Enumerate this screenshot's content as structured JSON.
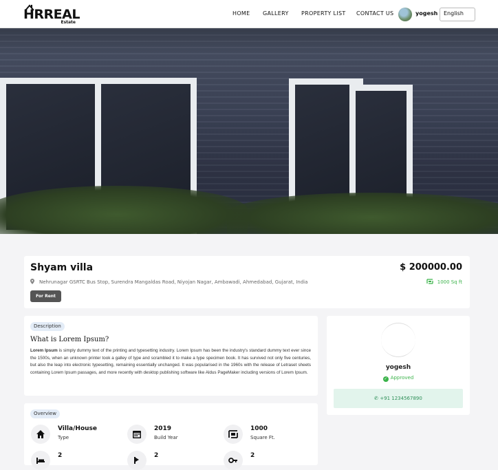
{
  "nav": {
    "logo_main": "HRREAL",
    "logo_sub": "Estate",
    "links": [
      "HOME",
      "GALLERY",
      "PROPERTY LIST",
      "CONTACT US"
    ],
    "user_name": "yogesh",
    "language": "English"
  },
  "property": {
    "title": "Shyam villa",
    "price": "$ 200000.00",
    "address": "Nehrunagar GSRTC Bus Stop, Surendra Mangaldas Road, Niyojan Nagar, Ambawadi, Ahmedabad, Gujarat, India",
    "area": "1000 Sq ft",
    "status_badge": "For Rent"
  },
  "description": {
    "pill": "Description",
    "heading": "What is Lorem Ipsum?",
    "lead": "Lorem Ipsum",
    "body": " is simply dummy text of the printing and typesetting industry. Lorem Ipsum has been the industry's standard dummy text ever since the 1500s, when an unknown printer took a galley of type and scrambled it to make a type specimen book. It has survived not only five centuries, but also the leap into electronic typesetting, remaining essentially unchanged. It was popularised in the 1960s with the release of Letraset sheets containing Lorem Ipsum passages, and more recently with desktop publishing software like Aldus PageMaker including versions of Lorem Ipsum."
  },
  "agent": {
    "name": "yogesh",
    "status": "Approved",
    "phone": "+91 1234567890"
  },
  "overview": {
    "pill": "Overview",
    "items": [
      {
        "value": "Villa/House",
        "label": "Type",
        "icon": "home-icon"
      },
      {
        "value": "2019",
        "label": "Build Year",
        "icon": "calendar-icon"
      },
      {
        "value": "1000",
        "label": "Square Ft.",
        "icon": "area-icon"
      },
      {
        "value": "2",
        "label": "",
        "icon": "bed-icon"
      },
      {
        "value": "2",
        "label": "",
        "icon": "bath-icon"
      },
      {
        "value": "2",
        "label": "",
        "icon": "key-icon"
      }
    ]
  },
  "colors": {
    "accent_green": "#3bb34a",
    "badge_gray": "#555555",
    "pill_blue": "#e3ecf7",
    "phone_bg": "#e2f4ec"
  }
}
